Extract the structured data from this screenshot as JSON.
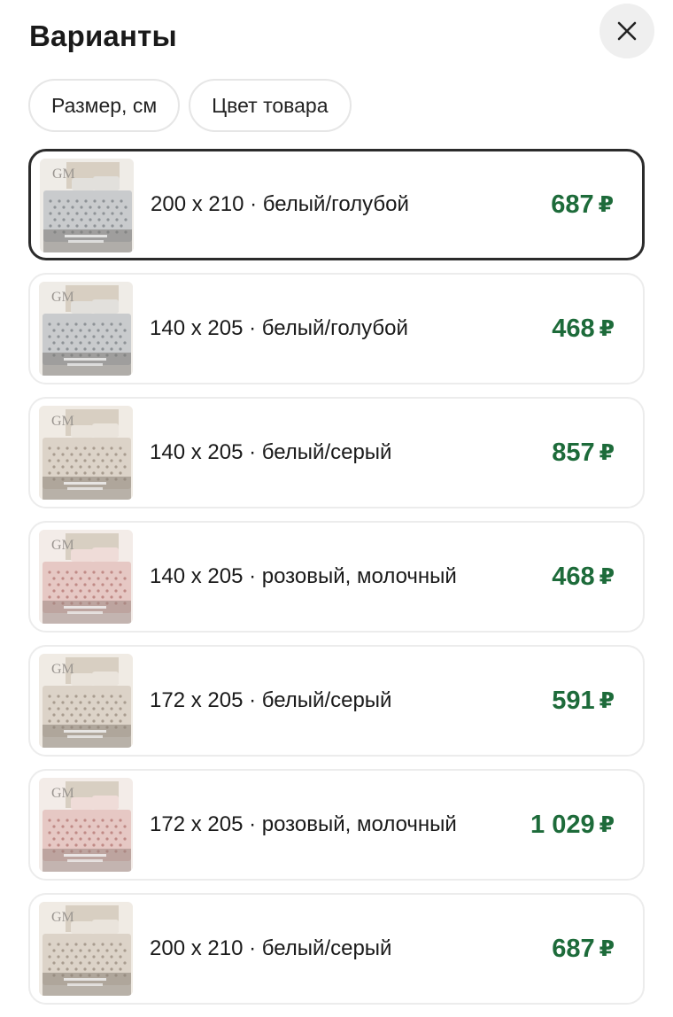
{
  "header": {
    "title": "Варианты",
    "close_icon": "close-icon"
  },
  "filters": [
    {
      "label": "Размер, см"
    },
    {
      "label": "Цвет товара"
    }
  ],
  "variants": [
    {
      "label": "200 x 210 · белый/голубой",
      "price": "687",
      "currency": "₽",
      "selected": true,
      "tone": "gray"
    },
    {
      "label": "140 x 205 · белый/голубой",
      "price": "468",
      "currency": "₽",
      "selected": false,
      "tone": "gray"
    },
    {
      "label": "140 x 205 · белый/серый",
      "price": "857",
      "currency": "₽",
      "selected": false,
      "tone": "beige"
    },
    {
      "label": "140 x 205 · розовый, молочный",
      "price": "468",
      "currency": "₽",
      "selected": false,
      "tone": "pink"
    },
    {
      "label": "172 x 205 · белый/серый",
      "price": "591",
      "currency": "₽",
      "selected": false,
      "tone": "beige"
    },
    {
      "label": "172 x 205 · розовый, молочный",
      "price": "1 029",
      "currency": "₽",
      "selected": false,
      "tone": "pink"
    },
    {
      "label": "200 x 210 · белый/серый",
      "price": "687",
      "currency": "₽",
      "selected": false,
      "tone": "beige"
    }
  ],
  "colors": {
    "price": "#1d6b3a",
    "selected_border": "#2b2b2b",
    "card_border": "#ececec",
    "close_bg": "#efefef"
  }
}
